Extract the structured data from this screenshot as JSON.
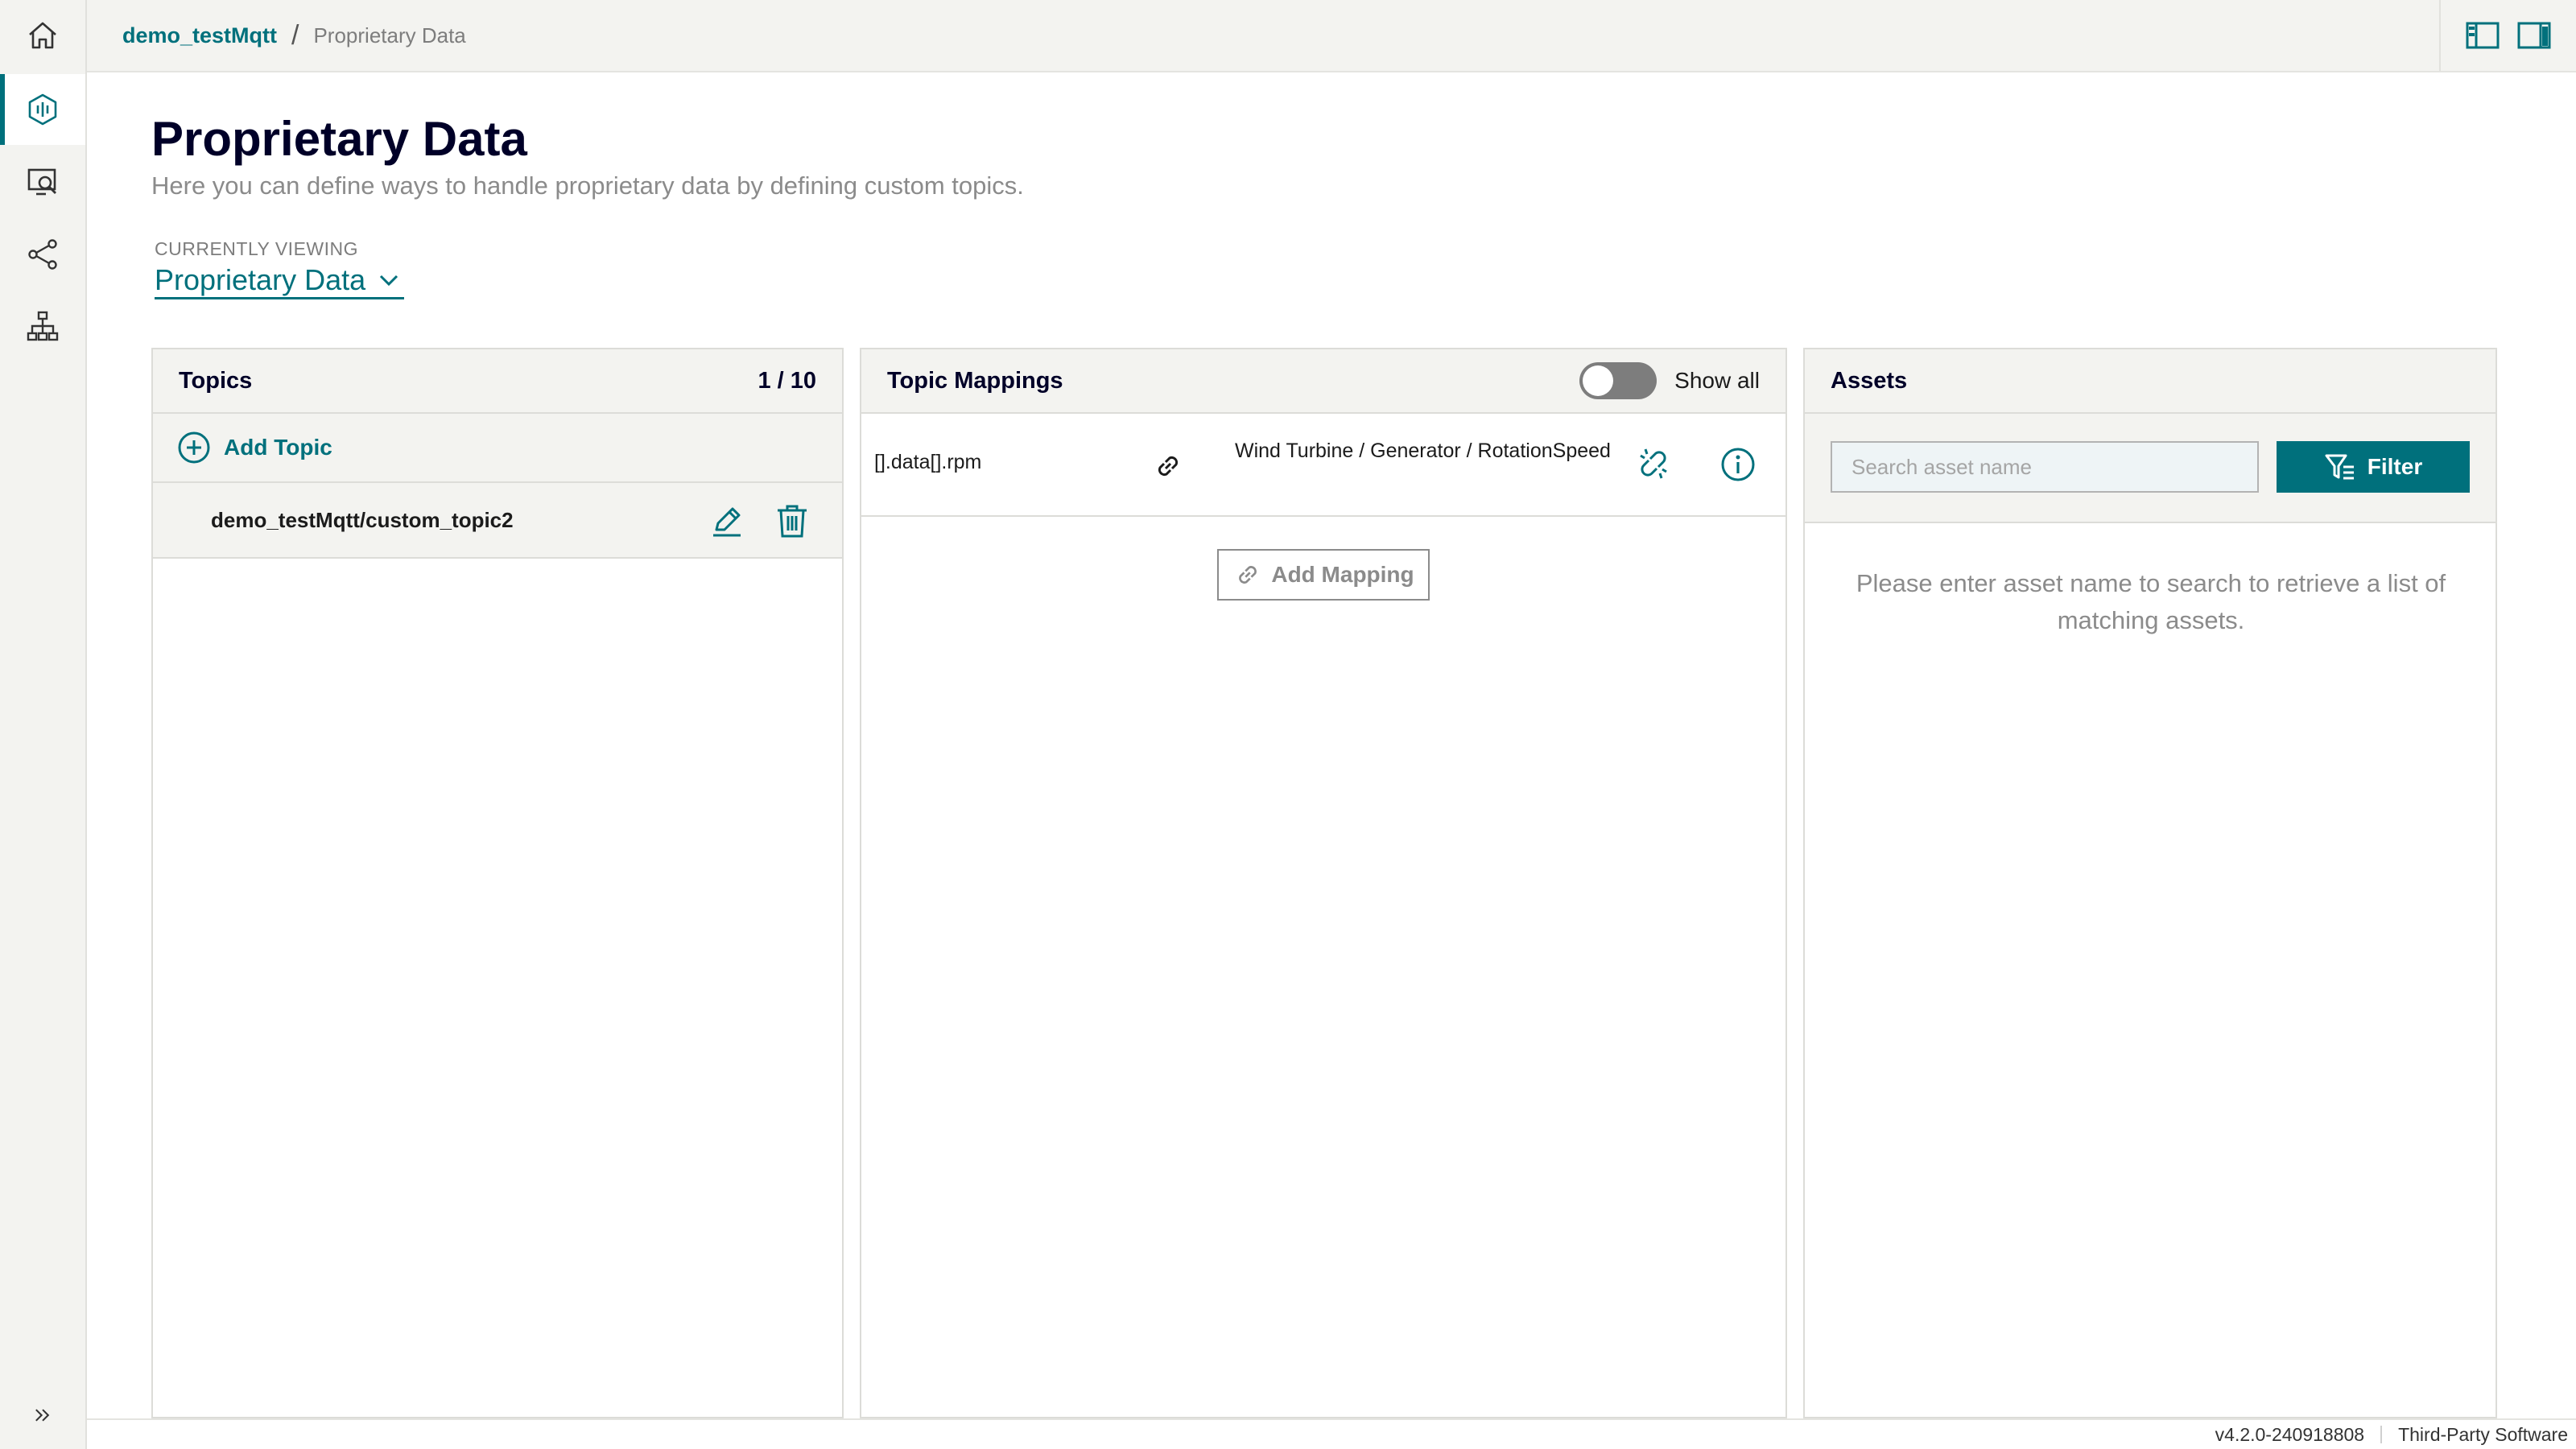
{
  "nav": {
    "items": [
      {
        "icon": "home-icon",
        "active": false
      },
      {
        "icon": "data-flow-icon",
        "active": true
      },
      {
        "icon": "monitor-search-icon",
        "active": false
      },
      {
        "icon": "share-nodes-icon",
        "active": false
      },
      {
        "icon": "hierarchy-icon",
        "active": false
      }
    ],
    "expand_icon": "double-chevron-right-icon"
  },
  "breadcrumb": {
    "parent": "demo_testMqtt",
    "separator": "/",
    "current": "Proprietary Data"
  },
  "topbar": {
    "icons": [
      "left-panel-icon",
      "right-panel-icon"
    ]
  },
  "header": {
    "title": "Proprietary Data",
    "subtitle": "Here you can define ways to handle proprietary data by defining custom topics.",
    "viewing_label": "CURRENTLY VIEWING",
    "viewing_value": "Proprietary Data"
  },
  "topics": {
    "title": "Topics",
    "count": "1 / 10",
    "add_label": "Add Topic",
    "items": [
      {
        "name": "demo_testMqtt/custom_topic2"
      }
    ]
  },
  "mappings": {
    "title": "Topic Mappings",
    "show_all_label": "Show all",
    "show_all_on": false,
    "rows": [
      {
        "source": "[].data[].rpm",
        "target": "Wind Turbine / Generator / RotationSpeed"
      }
    ],
    "add_label": "Add Mapping"
  },
  "assets": {
    "title": "Assets",
    "search_placeholder": "Search asset name",
    "search_value": "",
    "filter_label": "Filter",
    "empty_message": "Please enter asset name to search to retrieve a list of matching assets."
  },
  "footer": {
    "version": "v4.2.0-240918808",
    "third_party": "Third-Party Software"
  },
  "colors": {
    "accent": "#00707c",
    "title": "#000028",
    "muted": "#8b8b8b",
    "panel_bg": "#f3f3f0"
  }
}
